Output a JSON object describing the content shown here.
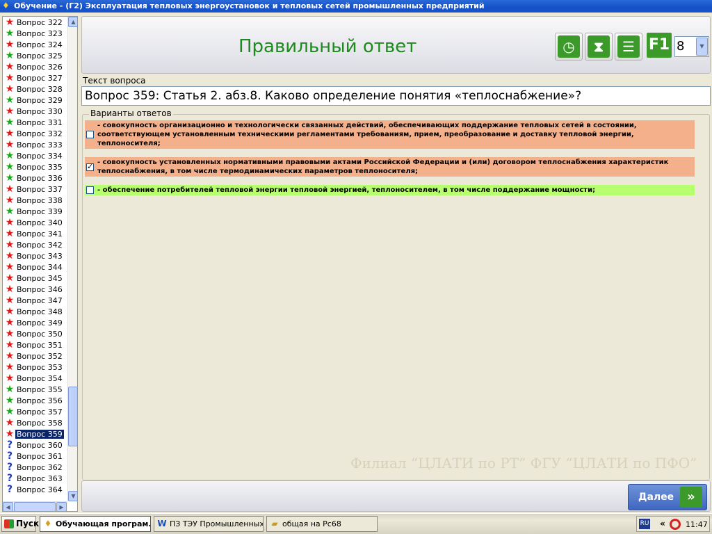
{
  "window": {
    "title": "Обучение - (Г2) Эксплуатация тепловых энергоустановок и тепловых сетей промышленных предприятий"
  },
  "questions": [
    {
      "label": "Вопрос 322",
      "status": "red"
    },
    {
      "label": "Вопрос 323",
      "status": "green"
    },
    {
      "label": "Вопрос 324",
      "status": "red"
    },
    {
      "label": "Вопрос 325",
      "status": "green"
    },
    {
      "label": "Вопрос 326",
      "status": "red"
    },
    {
      "label": "Вопрос 327",
      "status": "red"
    },
    {
      "label": "Вопрос 328",
      "status": "red"
    },
    {
      "label": "Вопрос 329",
      "status": "green"
    },
    {
      "label": "Вопрос 330",
      "status": "red"
    },
    {
      "label": "Вопрос 331",
      "status": "green"
    },
    {
      "label": "Вопрос 332",
      "status": "red"
    },
    {
      "label": "Вопрос 333",
      "status": "red"
    },
    {
      "label": "Вопрос 334",
      "status": "green"
    },
    {
      "label": "Вопрос 335",
      "status": "green"
    },
    {
      "label": "Вопрос 336",
      "status": "green"
    },
    {
      "label": "Вопрос 337",
      "status": "red"
    },
    {
      "label": "Вопрос 338",
      "status": "red"
    },
    {
      "label": "Вопрос 339",
      "status": "green"
    },
    {
      "label": "Вопрос 340",
      "status": "red"
    },
    {
      "label": "Вопрос 341",
      "status": "red"
    },
    {
      "label": "Вопрос 342",
      "status": "red"
    },
    {
      "label": "Вопрос 343",
      "status": "red"
    },
    {
      "label": "Вопрос 344",
      "status": "red"
    },
    {
      "label": "Вопрос 345",
      "status": "red"
    },
    {
      "label": "Вопрос 346",
      "status": "red"
    },
    {
      "label": "Вопрос 347",
      "status": "red"
    },
    {
      "label": "Вопрос 348",
      "status": "red"
    },
    {
      "label": "Вопрос 349",
      "status": "red"
    },
    {
      "label": "Вопрос 350",
      "status": "red"
    },
    {
      "label": "Вопрос 351",
      "status": "red"
    },
    {
      "label": "Вопрос 352",
      "status": "red"
    },
    {
      "label": "Вопрос 353",
      "status": "red"
    },
    {
      "label": "Вопрос 354",
      "status": "red"
    },
    {
      "label": "Вопрос 355",
      "status": "green"
    },
    {
      "label": "Вопрос 356",
      "status": "green"
    },
    {
      "label": "Вопрос 357",
      "status": "green"
    },
    {
      "label": "Вопрос 358",
      "status": "red"
    },
    {
      "label": "Вопрос 359",
      "status": "red",
      "selected": true
    },
    {
      "label": "Вопрос 360",
      "status": "unanswered"
    },
    {
      "label": "Вопрос 361",
      "status": "unanswered"
    },
    {
      "label": "Вопрос 362",
      "status": "unanswered"
    },
    {
      "label": "Вопрос 363",
      "status": "unanswered"
    },
    {
      "label": "Вопрос 364",
      "status": "unanswered"
    }
  ],
  "header": {
    "result_title": "Правильный ответ",
    "tools": [
      "clock-icon",
      "hourglass-icon",
      "list-icon",
      "f1-help-icon"
    ],
    "f1_label": "F1",
    "font_size_value": "8"
  },
  "question": {
    "section_label": "Текст вопроса",
    "text": "Вопрос 359: Статья 2. абз.8. Каково определение понятия «теплоснабжение»?"
  },
  "answers": {
    "group_label": "Варианты ответов",
    "options": [
      {
        "text": "- совокупность организационно и технологически связанных действий, обеспечивающих поддержание тепловых сетей в состоянии, соответствующем установленным техническими регламентами требованиям, прием, преобразование и доставку тепловой энергии, теплоносителя;",
        "checked": false,
        "color": "#f4b08a"
      },
      {
        "text": "- совокупность установленных нормативными правовыми актами Российской Федерации и (или) договором теплоснабжения характеристик теплоснабжения, в том числе термодинамических параметров теплоносителя;",
        "checked": true,
        "color": "#f4b08a"
      },
      {
        "text": "- обеспечение потребителей тепловой энергии тепловой энергией, теплоносителем, в том числе поддержание мощности;",
        "checked": false,
        "color": "#b8ff70"
      }
    ]
  },
  "watermark": "Филиал “ЦЛАТИ по РТ” ФГУ “ЦЛАТИ по ПФО”",
  "footer": {
    "next_label": "Далее"
  },
  "taskbar": {
    "start_label": "Пуск",
    "tasks": [
      {
        "label": "Обучающая програм...",
        "active": true
      },
      {
        "label": "ПЗ ТЭУ Промышленных...",
        "active": false
      },
      {
        "label": "общая на Pc68",
        "active": false
      }
    ],
    "lang": "RU",
    "time": "11:47"
  },
  "colors": {
    "result_title": "#1d8a1d",
    "wrong": "#f4b08a",
    "correct": "#b8ff70",
    "accent": "#3c9a2a"
  }
}
